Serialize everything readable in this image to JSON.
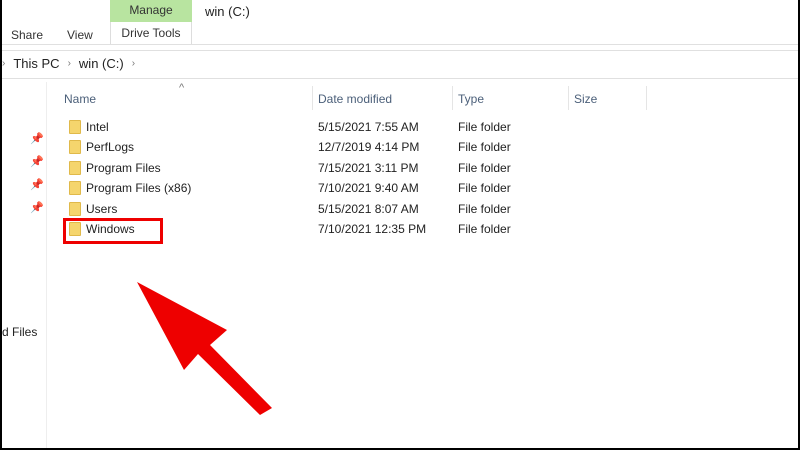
{
  "ribbon": {
    "tabs": [
      "Share",
      "View"
    ],
    "context_group": "Manage",
    "context_tab": "Drive Tools",
    "title": "win (C:)"
  },
  "breadcrumb": [
    "This PC",
    "win (C:)"
  ],
  "nav": {
    "partial_label": "d Files"
  },
  "columns": [
    "Name",
    "Date modified",
    "Type",
    "Size"
  ],
  "rows": [
    {
      "name": "Intel",
      "date": "5/15/2021 7:55 AM",
      "type": "File folder"
    },
    {
      "name": "PerfLogs",
      "date": "12/7/2019 4:14 PM",
      "type": "File folder"
    },
    {
      "name": "Program Files",
      "date": "7/15/2021 3:11 PM",
      "type": "File folder"
    },
    {
      "name": "Program Files (x86)",
      "date": "7/10/2021 9:40 AM",
      "type": "File folder"
    },
    {
      "name": "Users",
      "date": "5/15/2021 8:07 AM",
      "type": "File folder"
    },
    {
      "name": "Windows",
      "date": "7/10/2021 12:35 PM",
      "type": "File folder"
    }
  ],
  "colors": {
    "highlight": "#ee0000",
    "context": "#b8e4a0"
  }
}
